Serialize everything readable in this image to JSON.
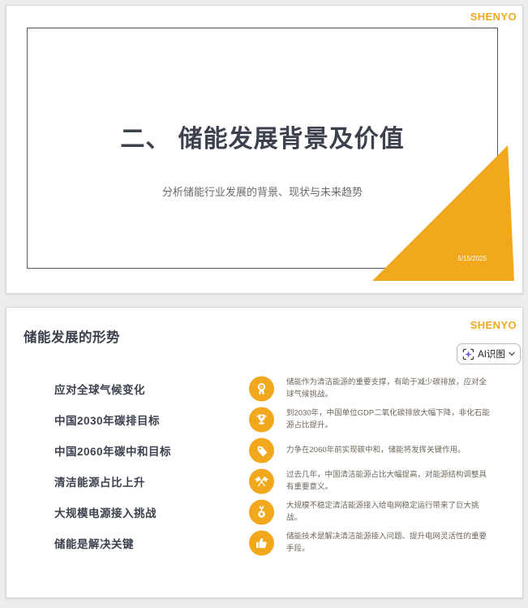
{
  "brand": {
    "name": "SHENYO"
  },
  "colors": {
    "accent": "#F2A81C",
    "ai_sparkle": "#7B52F0",
    "title_text": "#3c414d"
  },
  "slide1": {
    "logo": "SHENYO",
    "title": "二、 储能发展背景及价值",
    "subtitle": "分析储能行业发展的背景、现状与未来趋势",
    "date": "5/15/2025"
  },
  "slide2": {
    "logo": "SHENYO",
    "title": "储能发展的形势",
    "ai_button": {
      "label": "AI识图",
      "icon": "ai-scan-sparkle-icon",
      "chevron": "chevron-down-icon"
    },
    "rows": [
      {
        "label": "应对全球气候变化",
        "icon": "award-rosette-icon",
        "desc": "储能作为清洁能源的重要支撑，有助于减少碳排放，应对全球气候挑战。"
      },
      {
        "label": "中国2030年碳排目标",
        "icon": "trophy-icon",
        "desc": "到2030年，中国单位GDP二氧化碳排放大幅下降，非化石能源占比提升。"
      },
      {
        "label": "中国2060年碳中和目标",
        "icon": "price-tag-icon",
        "desc": "力争在2060年前实现碳中和，储能将发挥关键作用。"
      },
      {
        "label": "清洁能源占比上升",
        "icon": "crossed-flags-icon",
        "desc": "过去几年，中国清洁能源占比大幅提高，对能源结构调整具有重要意义。"
      },
      {
        "label": "大规模电源接入挑战",
        "icon": "medal-star-icon",
        "desc": "大规模不稳定清洁能源接入给电网稳定运行带来了巨大挑战。"
      },
      {
        "label": "储能是解决关键",
        "icon": "thumbs-up-icon",
        "desc": "储能技术是解决清洁能源接入问题、提升电网灵活性的重要手段。"
      }
    ]
  }
}
